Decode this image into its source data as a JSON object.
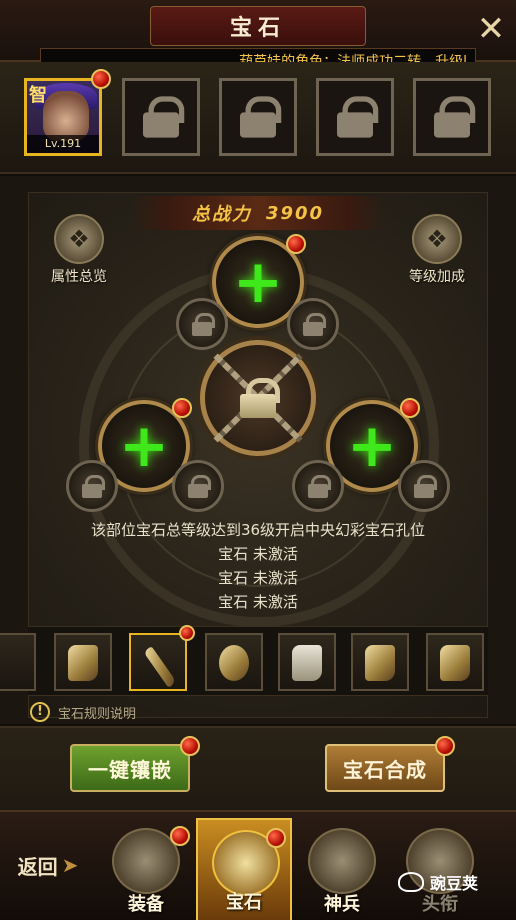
{
  "header": {
    "title": "宝石",
    "close_icon": "close-icon",
    "marquee": "葫芦娃的角色：法师成功二转，升级l"
  },
  "roles": [
    {
      "slot": "active",
      "tag": "智",
      "level": "Lv.191"
    },
    {
      "slot": "locked"
    },
    {
      "slot": "locked"
    },
    {
      "slot": "locked"
    },
    {
      "slot": "locked"
    }
  ],
  "panel": {
    "power_label": "总战力",
    "power_value": "3900",
    "attr_overview": "属性总览",
    "level_bonus": "等级加成",
    "hint": "该部位宝石总等级达到36级开启中央幻彩宝石孔位",
    "status_lines": [
      "宝石 未激活",
      "宝石 未激活",
      "宝石 未激活"
    ]
  },
  "equipment": [
    "gloves",
    "staff",
    "necklace",
    "armor",
    "bracer",
    "boots"
  ],
  "rules_label": "宝石规则说明",
  "actions": {
    "one_click": "一键镶嵌",
    "synthesize": "宝石合成"
  },
  "nav": {
    "back": "返回",
    "tabs": [
      "装备",
      "宝石",
      "神兵",
      "头衔"
    ],
    "active_tab": "宝石"
  },
  "watermark": "豌豆荚",
  "colors": {
    "accent_gold": "#e8b520",
    "plus_green": "#3ee81a",
    "red_dot": "#c01208"
  }
}
